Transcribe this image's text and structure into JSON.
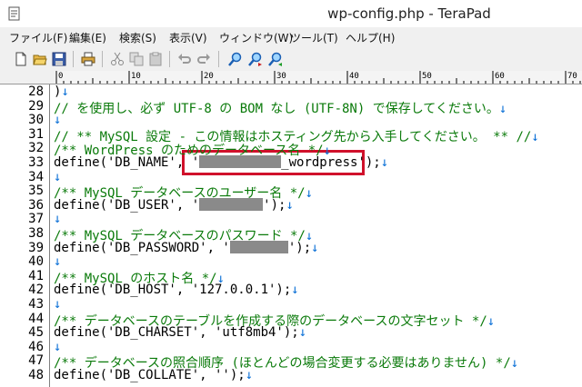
{
  "window": {
    "title": "wp-config.php - TeraPad"
  },
  "menu": [
    {
      "label": "ファイル(F)"
    },
    {
      "label": "編集(E)"
    },
    {
      "label": "検索(S)"
    },
    {
      "label": "表示(V)"
    },
    {
      "label": "ウィンドウ(W)"
    },
    {
      "label": "ツール(T)"
    },
    {
      "label": "ヘルプ(H)"
    }
  ],
  "toolbar": {
    "icons": [
      "new-file-icon",
      "open-folder-icon",
      "save-icon",
      "print-icon",
      "cut-icon",
      "copy-icon",
      "paste-icon",
      "undo-icon",
      "redo-icon",
      "find-icon",
      "find-next-icon",
      "find-prev-icon"
    ]
  },
  "ruler": {
    "ticks": [
      "0",
      "10",
      "20",
      "30",
      "40",
      "50",
      "60",
      "70"
    ]
  },
  "lines": [
    {
      "num": "28",
      "text": ")",
      "comment": false
    },
    {
      "num": "29",
      "text": "// を使用し、必ず UTF-8 の BOM なし (UTF-8N) で保存してください。",
      "comment": true
    },
    {
      "num": "30",
      "text": "",
      "comment": false
    },
    {
      "num": "31",
      "text": "// ** MySQL 設定 - この情報はホスティング先から入手してください。 ** //",
      "comment": true
    },
    {
      "num": "32",
      "text": "/** WordPress のためのデータベース名 */",
      "comment": true
    },
    {
      "num": "33",
      "pre": "define('DB_NAME', '",
      "post": "_wordpress');",
      "comment": false
    },
    {
      "num": "34",
      "text": "",
      "comment": false
    },
    {
      "num": "35",
      "text": "/** MySQL データベースのユーザー名 */",
      "comment": true
    },
    {
      "num": "36",
      "pre": "define('DB_USER', '",
      "post": "');",
      "comment": false
    },
    {
      "num": "37",
      "text": "",
      "comment": false
    },
    {
      "num": "38",
      "text": "/** MySQL データベースのパスワード */",
      "comment": true
    },
    {
      "num": "39",
      "pre": "define('DB_PASSWORD', '",
      "post": "');",
      "comment": false
    },
    {
      "num": "40",
      "text": "",
      "comment": false
    },
    {
      "num": "41",
      "text": "/** MySQL のホスト名 */",
      "comment": true
    },
    {
      "num": "42",
      "text": "define('DB_HOST', '127.0.0.1');",
      "comment": false
    },
    {
      "num": "43",
      "text": "",
      "comment": false
    },
    {
      "num": "44",
      "text": "/** データベースのテーブルを作成する際のデータベースの文字セット */",
      "comment": true
    },
    {
      "num": "45",
      "text": "define('DB_CHARSET', 'utf8mb4');",
      "comment": false
    },
    {
      "num": "46",
      "text": "",
      "comment": false
    },
    {
      "num": "47",
      "text": "/** データベースの照合順序 (ほとんどの場合変更する必要はありません) */",
      "comment": true
    },
    {
      "num": "48",
      "text": "define('DB_COLLATE', '');",
      "comment": false
    }
  ],
  "eol_mark": "↓",
  "colors": {
    "comment": "#0a7a0a",
    "eol": "#0a6fd6",
    "highlight": "#d0112b",
    "mask": "#8a8a8a"
  }
}
